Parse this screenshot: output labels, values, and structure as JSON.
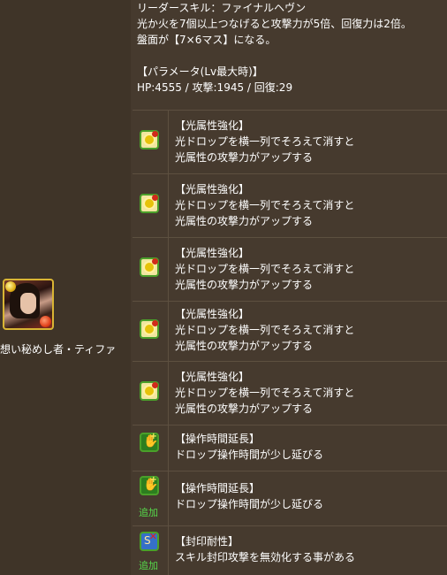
{
  "monster": {
    "name": "想い秘めし者・ティファ",
    "main_attribute_icon": "light-orb-icon",
    "sub_attribute_icon": "fire-orb-icon"
  },
  "leader": {
    "skill_line": "リーダースキル：ファイナルヘヴン",
    "desc1": "光か火を7個以上つなげると攻撃力が5倍、回復力は2倍。",
    "desc2": "盤面が【7×6マス】になる。",
    "param_title": "【パラメータ(Lv最大時)】",
    "params": "HP:4555 / 攻撃:1945 / 回復:29"
  },
  "awakenings": [
    {
      "icon": "light-enhance-icon",
      "title": "【光属性強化】",
      "line1": "光ドロップを横一列でそろえて消すと",
      "line2": "光属性の攻撃力がアップする",
      "add": ""
    },
    {
      "icon": "light-enhance-icon",
      "title": "【光属性強化】",
      "line1": "光ドロップを横一列でそろえて消すと",
      "line2": "光属性の攻撃力がアップする",
      "add": ""
    },
    {
      "icon": "light-enhance-icon",
      "title": "【光属性強化】",
      "line1": "光ドロップを横一列でそろえて消すと",
      "line2": "光属性の攻撃力がアップする",
      "add": ""
    },
    {
      "icon": "light-enhance-icon",
      "title": "【光属性強化】",
      "line1": "光ドロップを横一列でそろえて消すと",
      "line2": "光属性の攻撃力がアップする",
      "add": ""
    },
    {
      "icon": "light-enhance-icon",
      "title": "【光属性強化】",
      "line1": "光ドロップを横一列でそろえて消すと",
      "line2": "光属性の攻撃力がアップする",
      "add": ""
    },
    {
      "icon": "time-extend-icon",
      "title": "【操作時間延長】",
      "line1": "ドロップ操作時間が少し延びる",
      "line2": "",
      "add": ""
    },
    {
      "icon": "time-extend-icon",
      "title": "【操作時間延長】",
      "line1": "ドロップ操作時間が少し延びる",
      "line2": "",
      "add": "追加"
    },
    {
      "icon": "seal-resist-icon",
      "title": "【封印耐性】",
      "line1": "スキル封印攻撃を無効化する事がある",
      "line2": "",
      "add": "追加"
    }
  ]
}
